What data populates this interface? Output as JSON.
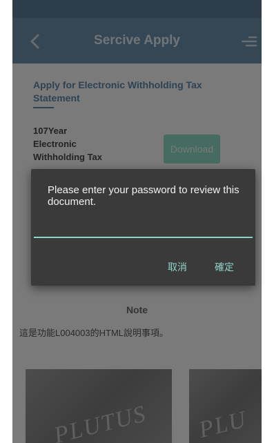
{
  "header": {
    "title": "Sercive Apply"
  },
  "section": {
    "title": "Apply for Electronic Withholding Tax Statement",
    "item_text": "107Year\nElectronic\nWithholding Tax",
    "download_label": "Download"
  },
  "note": {
    "title": "Note",
    "body": "這是功能L004003的HTML說明事項。"
  },
  "cards": [
    {
      "logo_text": "PLUTUS"
    },
    {
      "logo_text": "PLU"
    }
  ],
  "dialog": {
    "message": "Please enter your password to review this document.",
    "password_value": "",
    "cancel_label": "取消",
    "confirm_label": "確定"
  },
  "colors": {
    "app_bar": "#6a8ea8",
    "accent": "#8fd3c6",
    "dialog_bg": "#3a3a3a",
    "download_button": "#8dd7c1"
  },
  "icons": {
    "back": "chevron-left-icon",
    "menu": "menu-icon"
  }
}
